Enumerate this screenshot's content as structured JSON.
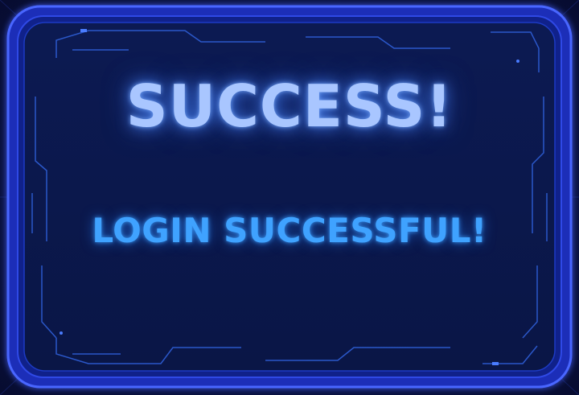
{
  "dialog": {
    "title": "SUCCESS!",
    "message": "LOGIN SUCCESSFUL!"
  },
  "colors": {
    "background": "#0a1240",
    "panel": "#0b1a4f",
    "frame_outer": "#3554ff",
    "frame_glow": "#4d6bff",
    "circuit_lines": "#2f5fd8",
    "title_text": "#a9c6ff",
    "message_text": "#3fa2ff"
  },
  "icons": {
    "frame": "circuit-frame"
  }
}
